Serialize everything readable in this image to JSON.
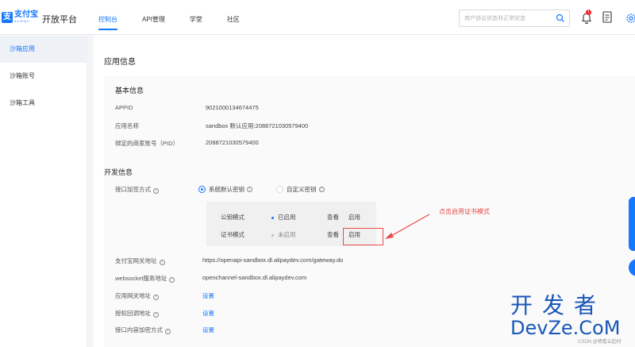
{
  "brand": {
    "logo_glyph": "支",
    "logo_cn": "支付宝",
    "logo_en": "ALIPAY",
    "platform": "开放平台",
    "accent": "#1677ff"
  },
  "nav": {
    "items": [
      {
        "label": "控制台",
        "active": true
      },
      {
        "label": "API管理",
        "active": false
      },
      {
        "label": "学堂",
        "active": false
      },
      {
        "label": "社区",
        "active": false
      }
    ]
  },
  "search": {
    "placeholder": "商户协议状态非正常状态"
  },
  "header_icons": {
    "bell": "bell-icon",
    "bell_badge": "1",
    "doc": "document-icon",
    "settings": "settings-icon"
  },
  "sidebar": {
    "items": [
      {
        "label": "沙箱应用",
        "active": true
      },
      {
        "label": "沙箱账号",
        "active": false
      },
      {
        "label": "沙箱工具",
        "active": false
      }
    ]
  },
  "main": {
    "title": "应用信息",
    "basic": {
      "title": "基本信息",
      "rows": [
        {
          "label": "APPID",
          "value": "9021000134674475"
        },
        {
          "label": "应用名称",
          "value": "sandbox 默认应用:2088721030579400"
        },
        {
          "label": "绑定的商家账号（PID）",
          "value": "2088721030579400"
        }
      ]
    },
    "dev": {
      "title": "开发信息",
      "sign_label": "接口加签方式",
      "options": [
        {
          "label": "系统默认密钥",
          "selected": true
        },
        {
          "label": "自定义密钥",
          "selected": false
        }
      ],
      "modes": [
        {
          "name": "公钥模式",
          "status": "已启用",
          "status_color": "#1677ff",
          "view": "查看",
          "action": "启用"
        },
        {
          "name": "证书模式",
          "status": "未启用",
          "status_color": "#bbbbbb",
          "view": "查看",
          "action": "启用"
        }
      ],
      "rows": [
        {
          "label": "支付宝网关地址",
          "value": "https://openapi-sandbox.dl.alipaydev.com/gateway.do",
          "is_link": false
        },
        {
          "label": "websocket服务地址",
          "value": "openchannel-sandbox.dl.alipaydev.com",
          "is_link": false
        },
        {
          "label": "应用网关地址",
          "value": "设置",
          "is_link": true
        },
        {
          "label": "授权回调地址",
          "value": "设置",
          "is_link": true
        },
        {
          "label": "接口内容加密方式",
          "value": "设置",
          "is_link": true
        }
      ]
    }
  },
  "annotation": {
    "text": "点击启用证书模式",
    "color": "#e94b4b"
  },
  "watermark": {
    "cn": "开发者",
    "en": "DevZe.CoM",
    "small": "CSDN @晴看云起时"
  }
}
